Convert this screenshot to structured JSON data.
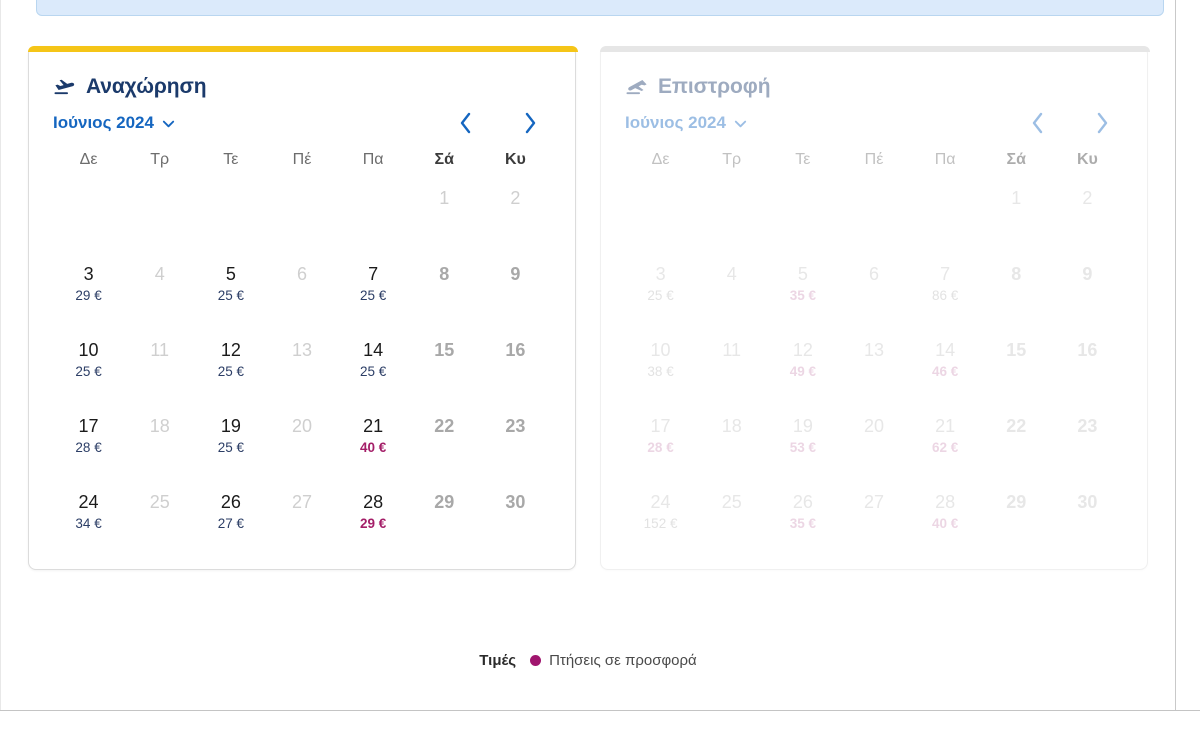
{
  "legend": {
    "title": "Τιμές",
    "sale_label": "Πτήσεις σε προσφορά",
    "dot_color": "#a0156e"
  },
  "colors": {
    "accent_bar": "#f5c518",
    "muted_bar": "#c4c4c4",
    "title_blue": "#1b3a6b",
    "link_blue": "#1566c0",
    "sale_magenta": "#a41e68",
    "price_navy": "#2c3e66",
    "info_panel": "#dbeafb"
  },
  "calendars": [
    {
      "id": "departure",
      "icon": "plane-departure-icon",
      "title": "Αναχώρηση",
      "month_label": "Ιούνιος 2024",
      "dropdown_icon": "chevron-down-icon",
      "prev_icon": "chevron-left-icon",
      "next_icon": "chevron-right-icon",
      "accent": "yellow",
      "dimmed": false,
      "weekdays": [
        "Δε",
        "Τρ",
        "Τε",
        "Πέ",
        "Πα",
        "Σά",
        "Κυ"
      ],
      "weekend_indexes": [
        5,
        6
      ],
      "leading_blanks": 5,
      "days": [
        {
          "num": "1",
          "price": "",
          "sale": false,
          "state": "disabled"
        },
        {
          "num": "2",
          "price": "",
          "sale": false,
          "state": "disabled"
        },
        {
          "num": "3",
          "price": "29 €",
          "sale": false,
          "state": "available"
        },
        {
          "num": "4",
          "price": "",
          "sale": false,
          "state": "disabled"
        },
        {
          "num": "5",
          "price": "25 €",
          "sale": false,
          "state": "available"
        },
        {
          "num": "6",
          "price": "",
          "sale": false,
          "state": "disabled"
        },
        {
          "num": "7",
          "price": "25 €",
          "sale": false,
          "state": "available"
        },
        {
          "num": "8",
          "price": "",
          "sale": false,
          "state": "weekend"
        },
        {
          "num": "9",
          "price": "",
          "sale": false,
          "state": "weekend"
        },
        {
          "num": "10",
          "price": "25 €",
          "sale": false,
          "state": "available"
        },
        {
          "num": "11",
          "price": "",
          "sale": false,
          "state": "disabled"
        },
        {
          "num": "12",
          "price": "25 €",
          "sale": false,
          "state": "available"
        },
        {
          "num": "13",
          "price": "",
          "sale": false,
          "state": "disabled"
        },
        {
          "num": "14",
          "price": "25 €",
          "sale": false,
          "state": "available"
        },
        {
          "num": "15",
          "price": "",
          "sale": false,
          "state": "weekend"
        },
        {
          "num": "16",
          "price": "",
          "sale": false,
          "state": "weekend"
        },
        {
          "num": "17",
          "price": "28 €",
          "sale": false,
          "state": "available"
        },
        {
          "num": "18",
          "price": "",
          "sale": false,
          "state": "disabled"
        },
        {
          "num": "19",
          "price": "25 €",
          "sale": false,
          "state": "available"
        },
        {
          "num": "20",
          "price": "",
          "sale": false,
          "state": "disabled"
        },
        {
          "num": "21",
          "price": "40 €",
          "sale": true,
          "state": "available"
        },
        {
          "num": "22",
          "price": "",
          "sale": false,
          "state": "weekend"
        },
        {
          "num": "23",
          "price": "",
          "sale": false,
          "state": "weekend"
        },
        {
          "num": "24",
          "price": "34 €",
          "sale": false,
          "state": "available"
        },
        {
          "num": "25",
          "price": "",
          "sale": false,
          "state": "disabled"
        },
        {
          "num": "26",
          "price": "27 €",
          "sale": false,
          "state": "available"
        },
        {
          "num": "27",
          "price": "",
          "sale": false,
          "state": "disabled"
        },
        {
          "num": "28",
          "price": "29 €",
          "sale": true,
          "state": "available"
        },
        {
          "num": "29",
          "price": "",
          "sale": false,
          "state": "weekend"
        },
        {
          "num": "30",
          "price": "",
          "sale": false,
          "state": "weekend"
        }
      ]
    },
    {
      "id": "return",
      "icon": "plane-arrival-icon",
      "title": "Επιστροφή",
      "month_label": "Ιούνιος 2024",
      "dropdown_icon": "chevron-down-icon",
      "prev_icon": "chevron-left-icon",
      "next_icon": "chevron-right-icon",
      "accent": "gray",
      "dimmed": true,
      "weekdays": [
        "Δε",
        "Τρ",
        "Τε",
        "Πέ",
        "Πα",
        "Σά",
        "Κυ"
      ],
      "weekend_indexes": [
        5,
        6
      ],
      "leading_blanks": 5,
      "days": [
        {
          "num": "1",
          "price": "",
          "sale": false,
          "state": "disabled"
        },
        {
          "num": "2",
          "price": "",
          "sale": false,
          "state": "disabled"
        },
        {
          "num": "3",
          "price": "25 €",
          "sale": false,
          "state": "available"
        },
        {
          "num": "4",
          "price": "",
          "sale": false,
          "state": "disabled"
        },
        {
          "num": "5",
          "price": "35 €",
          "sale": true,
          "state": "available"
        },
        {
          "num": "6",
          "price": "",
          "sale": false,
          "state": "disabled"
        },
        {
          "num": "7",
          "price": "86 €",
          "sale": false,
          "state": "available"
        },
        {
          "num": "8",
          "price": "",
          "sale": false,
          "state": "weekend"
        },
        {
          "num": "9",
          "price": "",
          "sale": false,
          "state": "weekend"
        },
        {
          "num": "10",
          "price": "38 €",
          "sale": false,
          "state": "available"
        },
        {
          "num": "11",
          "price": "",
          "sale": false,
          "state": "disabled"
        },
        {
          "num": "12",
          "price": "49 €",
          "sale": true,
          "state": "available"
        },
        {
          "num": "13",
          "price": "",
          "sale": false,
          "state": "disabled"
        },
        {
          "num": "14",
          "price": "46 €",
          "sale": true,
          "state": "available"
        },
        {
          "num": "15",
          "price": "",
          "sale": false,
          "state": "weekend"
        },
        {
          "num": "16",
          "price": "",
          "sale": false,
          "state": "weekend"
        },
        {
          "num": "17",
          "price": "28 €",
          "sale": true,
          "state": "available"
        },
        {
          "num": "18",
          "price": "",
          "sale": false,
          "state": "disabled"
        },
        {
          "num": "19",
          "price": "53 €",
          "sale": true,
          "state": "available"
        },
        {
          "num": "20",
          "price": "",
          "sale": false,
          "state": "disabled"
        },
        {
          "num": "21",
          "price": "62 €",
          "sale": true,
          "state": "available"
        },
        {
          "num": "22",
          "price": "",
          "sale": false,
          "state": "weekend"
        },
        {
          "num": "23",
          "price": "",
          "sale": false,
          "state": "weekend"
        },
        {
          "num": "24",
          "price": "152 €",
          "sale": false,
          "state": "available"
        },
        {
          "num": "25",
          "price": "",
          "sale": false,
          "state": "disabled"
        },
        {
          "num": "26",
          "price": "35 €",
          "sale": true,
          "state": "available"
        },
        {
          "num": "27",
          "price": "",
          "sale": false,
          "state": "disabled"
        },
        {
          "num": "28",
          "price": "40 €",
          "sale": true,
          "state": "available"
        },
        {
          "num": "29",
          "price": "",
          "sale": false,
          "state": "weekend"
        },
        {
          "num": "30",
          "price": "",
          "sale": false,
          "state": "weekend"
        }
      ]
    }
  ]
}
